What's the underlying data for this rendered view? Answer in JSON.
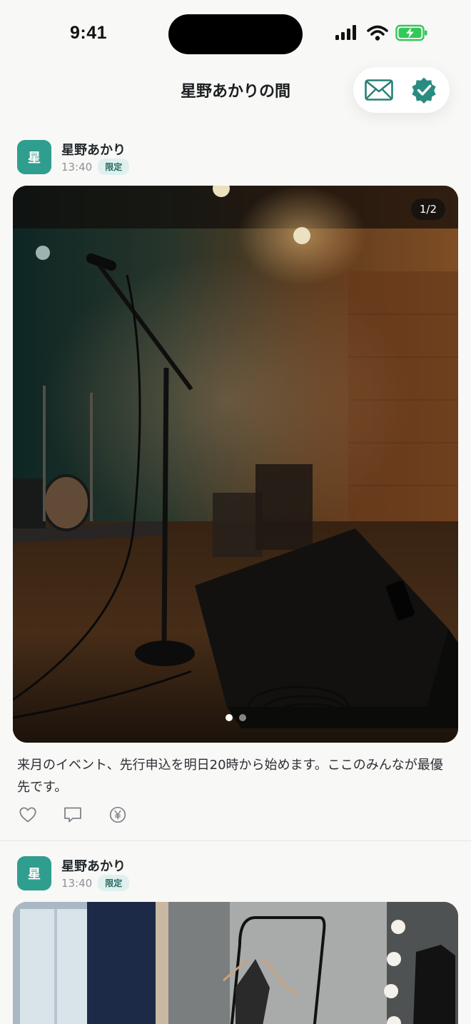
{
  "status_bar": {
    "time": "9:41"
  },
  "header": {
    "title": "星野あかりの間"
  },
  "posts": [
    {
      "author": "星野あかり",
      "avatar_char": "星",
      "time": "13:40",
      "badge": "限定",
      "counter": "1/2",
      "image_desc": "live-house-stage-microphone",
      "caption": "来月のイベント、先行申込を明日20時から始めます。ここのみんなが最優先です。"
    },
    {
      "author": "星野あかり",
      "avatar_char": "星",
      "time": "13:40",
      "badge": "限定",
      "image_desc": "dressing-room-clothes-rack"
    }
  ],
  "icons": {
    "mail": "mail-icon",
    "verified": "verified-badge-icon",
    "like": "heart-icon",
    "comment": "comment-icon",
    "tip": "yen-coin-icon"
  },
  "colors": {
    "accent": "#2f9e8f",
    "badge_bg": "#dff0ee",
    "background": "#f8f8f6"
  }
}
